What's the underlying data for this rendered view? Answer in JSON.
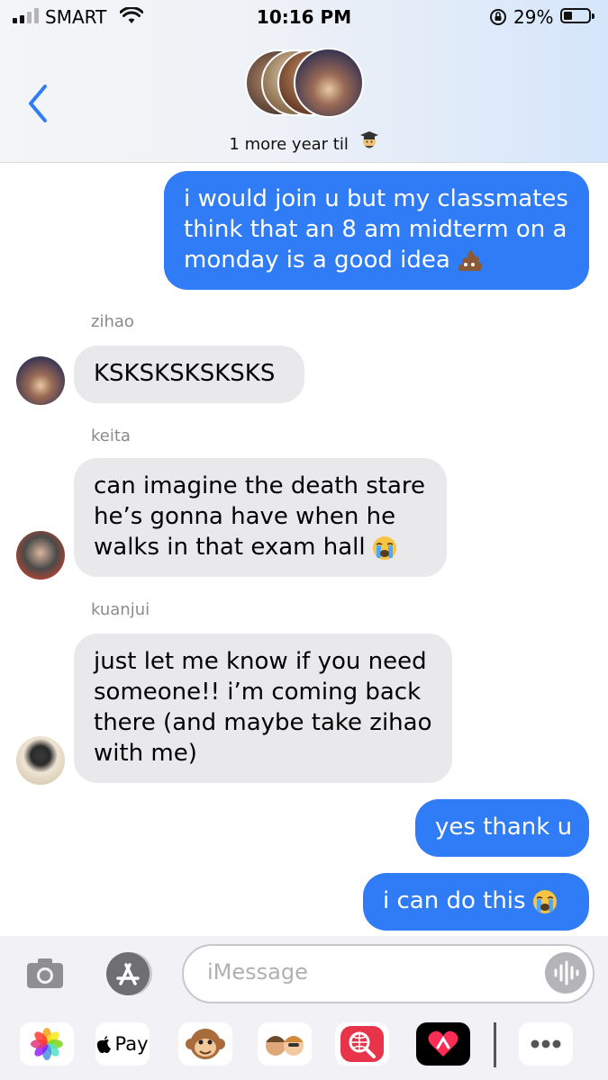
{
  "status_bar": {
    "carrier": "SMART",
    "time": "10:16 PM",
    "battery_percent": "29%",
    "battery_level": 0.29,
    "signal_bars": 2
  },
  "header": {
    "group_name": "1 more year til",
    "group_emoji_icon": "graduate-emoji"
  },
  "messages": [
    {
      "direction": "outgoing",
      "lines": [
        "i would join u but my classmates",
        "think that an 8 am midterm on a",
        "monday is a good idea"
      ],
      "emoji": "poop-emoji"
    },
    {
      "direction": "incoming",
      "sender": "zihao",
      "lines": [
        "KSKSKSKSKSKS"
      ]
    },
    {
      "direction": "incoming",
      "sender": "keita",
      "lines": [
        "can imagine the death stare",
        "he’s gonna have when he",
        "walks in that exam hall"
      ],
      "emoji": "crying-emoji"
    },
    {
      "direction": "incoming",
      "sender": "kuanjui",
      "lines": [
        "just let me know if you need",
        "someone!! i’m coming back",
        "there (and maybe take zihao",
        "with me)"
      ]
    },
    {
      "direction": "outgoing",
      "lines": [
        "yes thank u"
      ]
    },
    {
      "direction": "outgoing",
      "lines": [
        "i can do this"
      ],
      "emoji": "crying-emoji"
    }
  ],
  "compose": {
    "placeholder": "iMessage"
  },
  "app_drawer": {
    "pay_label": "Pay",
    "apps": [
      "photos-icon",
      "apple-pay-icon",
      "monkey-animoji-icon",
      "memoji-icon",
      "web-search-icon",
      "digital-touch-icon",
      "more-icon"
    ]
  },
  "colors": {
    "outgoing_bubble": "#2f7cf6",
    "incoming_bubble": "#e9e9eb",
    "accent": "#2f7cf6"
  }
}
